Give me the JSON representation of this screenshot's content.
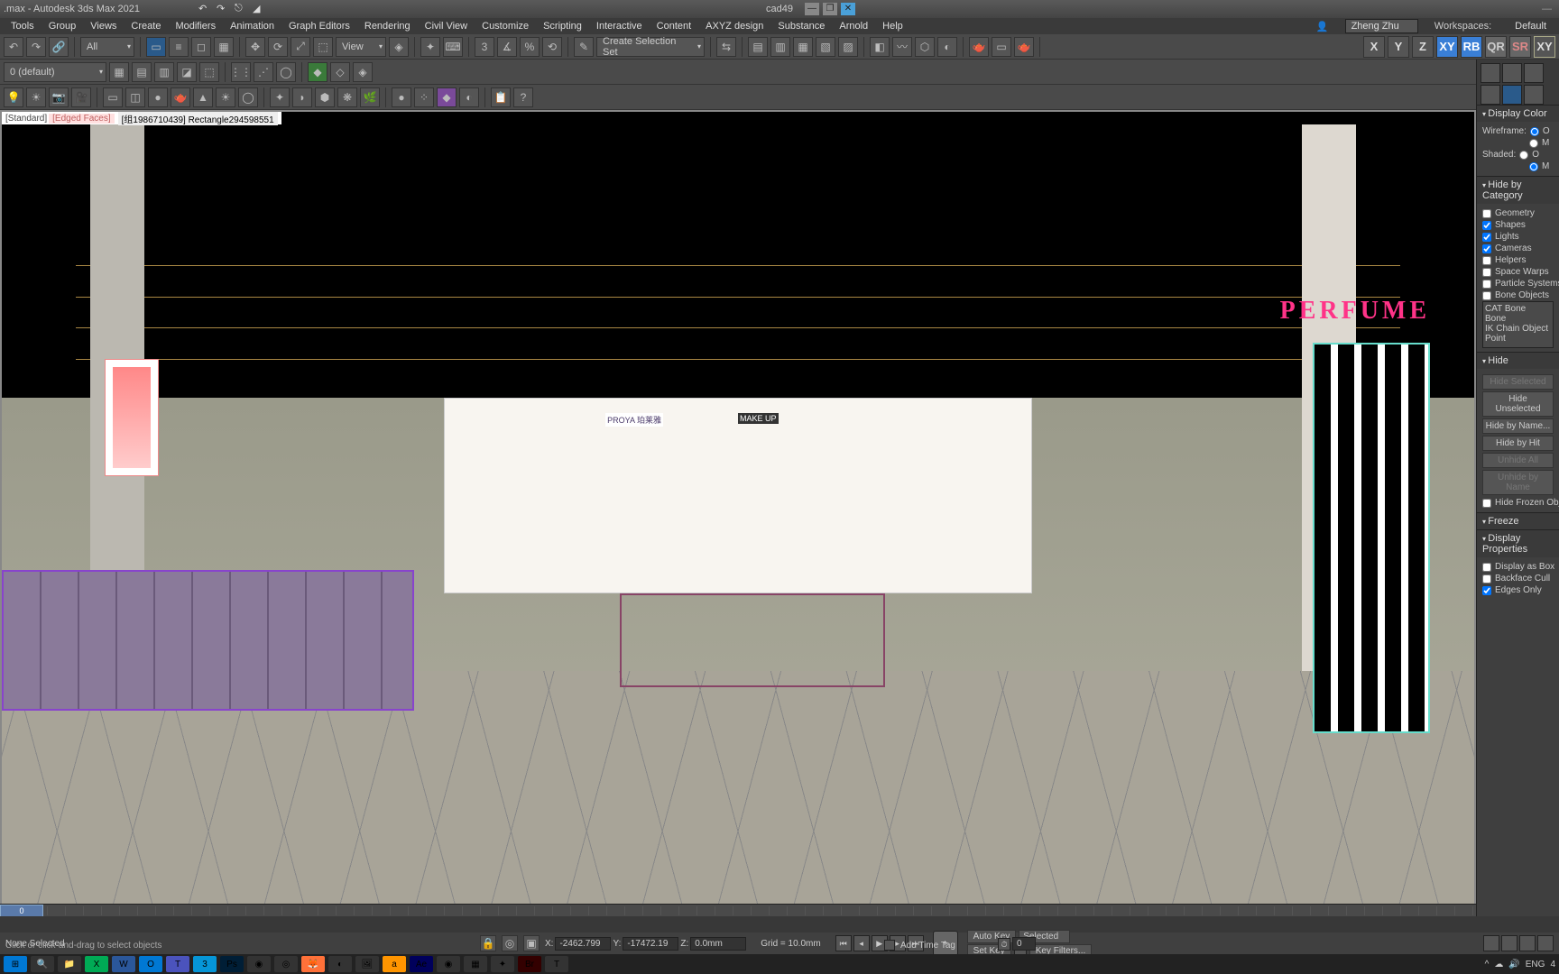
{
  "app": {
    "title_left": ".max - Autodesk 3ds Max 2021",
    "title_center": "cad49"
  },
  "menu": {
    "items": [
      "Tools",
      "Group",
      "Views",
      "Create",
      "Modifiers",
      "Animation",
      "Graph Editors",
      "Rendering",
      "Civil View",
      "Customize",
      "Scripting",
      "Interactive",
      "Content",
      "AXYZ design",
      "Substance",
      "Arnold",
      "Help"
    ],
    "user": "Zheng Zhu",
    "workspaces_label": "Workspaces:",
    "workspaces_value": "Default"
  },
  "toolbar1": {
    "filter_all": "All",
    "view_dd": "View",
    "sel_set": "Create Selection Set",
    "axis": {
      "x": "X",
      "y": "Y",
      "z": "Z",
      "xy": "XY",
      "rb": "RB",
      "qr": "QR",
      "sr": "SR",
      "xyz": "XY"
    }
  },
  "toolbar2": {
    "layer_dd": "0 (default)"
  },
  "viewport": {
    "label_standard": "[Standard]",
    "label_edged": "[Edged Faces]",
    "label_obj": "[组1986710439] Rectangle294598551",
    "sign": "PERFUME",
    "brand1": "PROYA 珀莱雅",
    "brand2": "MAKE UP"
  },
  "panel": {
    "rollouts": {
      "display_color": {
        "title": "Display Color",
        "wireframe_label": "Wireframe:",
        "shaded_label": "Shaded:",
        "opt_o": "O",
        "opt_m": "M"
      },
      "hide_cat": {
        "title": "Hide by Category",
        "items": [
          {
            "label": "Geometry",
            "checked": false
          },
          {
            "label": "Shapes",
            "checked": true
          },
          {
            "label": "Lights",
            "checked": true
          },
          {
            "label": "Cameras",
            "checked": true
          },
          {
            "label": "Helpers",
            "checked": false
          },
          {
            "label": "Space Warps",
            "checked": false
          },
          {
            "label": "Particle Systems",
            "checked": false
          },
          {
            "label": "Bone Objects",
            "checked": false
          }
        ],
        "list": [
          "CAT Bone",
          "Bone",
          "IK Chain Object",
          "Point"
        ]
      },
      "hide": {
        "title": "Hide",
        "buttons": [
          "Hide Selected",
          "Hide Unselected",
          "Hide by Name...",
          "Hide by Hit",
          "",
          "Unhide All",
          "Unhide by Name",
          "Hide Frozen Objects"
        ]
      },
      "freeze": {
        "title": "Freeze"
      },
      "disp_prop": {
        "title": "Display Properties",
        "items": [
          {
            "label": "Display as Box",
            "checked": false
          },
          {
            "label": "Backface Cull",
            "checked": false
          },
          {
            "label": "Edges Only",
            "checked": true
          }
        ]
      }
    }
  },
  "timeline": {
    "frame": "0"
  },
  "status": {
    "selection": "None Selected",
    "prompt": "Click or click-and-drag to select objects",
    "x_label": "X:",
    "x_val": "-2462.799",
    "y_label": "Y:",
    "y_val": "-17472.19",
    "z_label": "Z:",
    "z_val": "0.0mm",
    "grid": "Grid = 10.0mm",
    "add_time_tag": "Add Time Tag",
    "autokey": "Auto Key",
    "setkey": "Set Key",
    "selected_dd": "Selected",
    "keyfilters": "Key Filters...",
    "frame_spin": "0"
  },
  "wintask": {
    "tray": {
      "lang": "ENG",
      "time": "4"
    }
  }
}
